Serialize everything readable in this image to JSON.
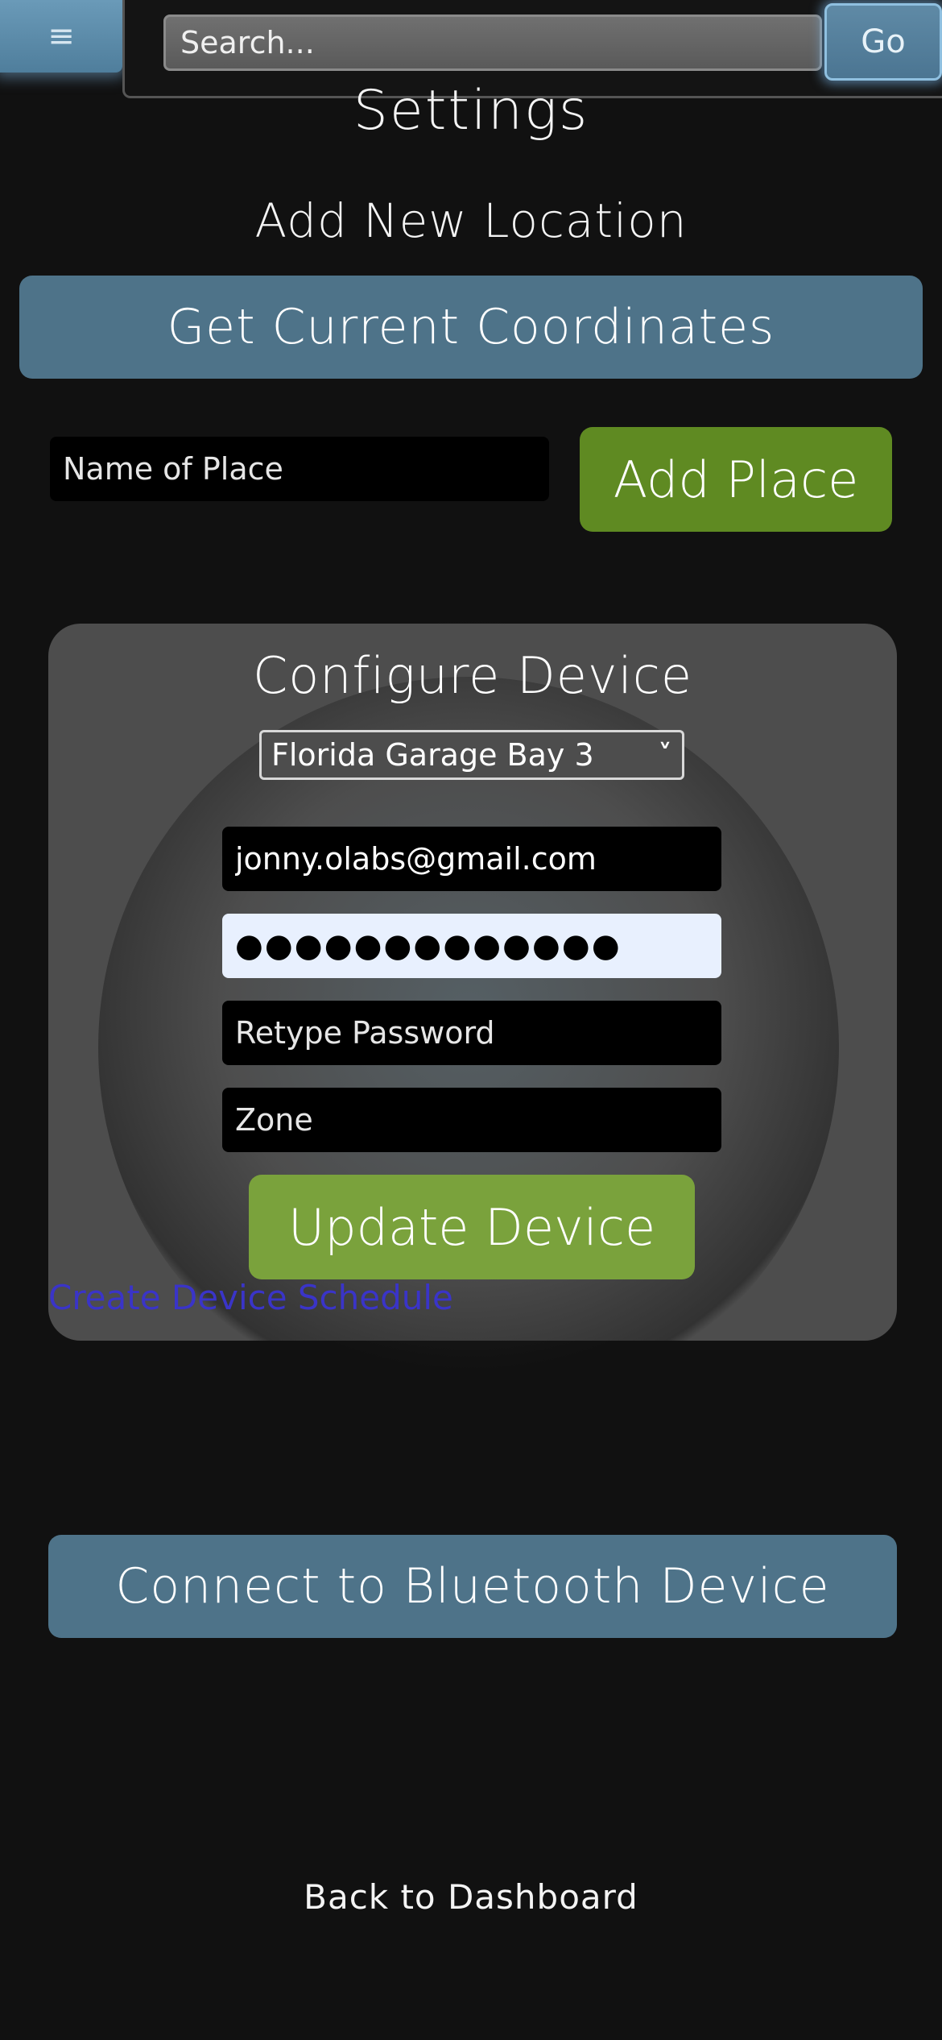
{
  "header": {
    "menu_icon": "hamburger-icon",
    "menu_glyph": "≡",
    "search_placeholder": "Search...",
    "go_label": "Go"
  },
  "page": {
    "title": "Settings"
  },
  "add_location": {
    "heading": "Add New Location",
    "coords_button": "Get Current Coordinates",
    "place_placeholder": "Name of Place",
    "add_place_button": "Add Place"
  },
  "configure_device": {
    "title": "Configure Device",
    "selected_device": "Florida Garage Bay 3",
    "select_chevron": "⌄",
    "email_value": "jonny.olabs@gmail.com",
    "password_value": "●●●●●●●●●●●●●",
    "retype_placeholder": "Retype Password",
    "zone_placeholder": "Zone",
    "update_button": "Update Device",
    "schedule_link": "Create Device Schedule"
  },
  "bluetooth": {
    "button": "Connect to Bluetooth Device"
  },
  "footer": {
    "back_link": "Back to Dashboard"
  },
  "colors": {
    "background": "#111111",
    "blue_button": "#4e7389",
    "green_button": "#5f8a22",
    "light_green_button": "#7aa23c",
    "card": "#4d4d4d",
    "link": "#3a34c8"
  }
}
